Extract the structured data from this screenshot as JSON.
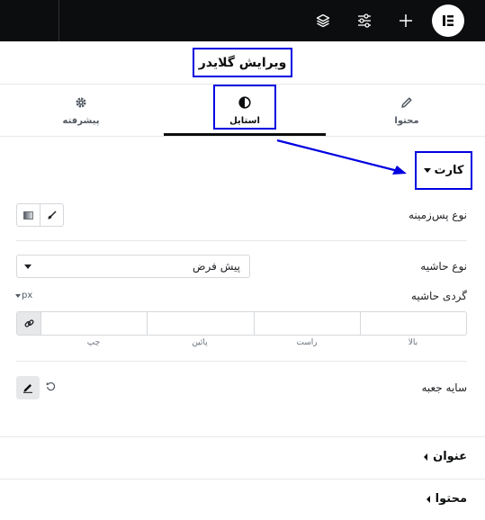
{
  "header": {
    "title": "ویرایش گلایدر"
  },
  "topbar": {
    "icons": [
      "layers-icon",
      "settings-sliders-icon",
      "plus-icon",
      "elementor-logo-icon"
    ]
  },
  "tabs": [
    {
      "label": "محتوا",
      "icon": "pencil-icon"
    },
    {
      "label": "استایل",
      "icon": "contrast-icon"
    },
    {
      "label": "پیشرفته",
      "icon": "gear-icon"
    }
  ],
  "section": {
    "title": "کارت"
  },
  "controls": {
    "background_type_label": "نوع پس‌زمینه",
    "border_type_label": "نوع حاشیه",
    "border_type_value": "پیش فرض",
    "border_radius_label": "گردی حاشیه",
    "unit": "px",
    "dims": {
      "top": "بالا",
      "right": "راست",
      "bottom": "پائین",
      "left": "چپ"
    },
    "box_shadow_label": "سایه جعبه"
  },
  "accordions": [
    {
      "label": "عنوان"
    },
    {
      "label": "محتوا"
    }
  ],
  "colors": {
    "annotation": "#0000e0",
    "topbar": "#0c0d0e"
  }
}
